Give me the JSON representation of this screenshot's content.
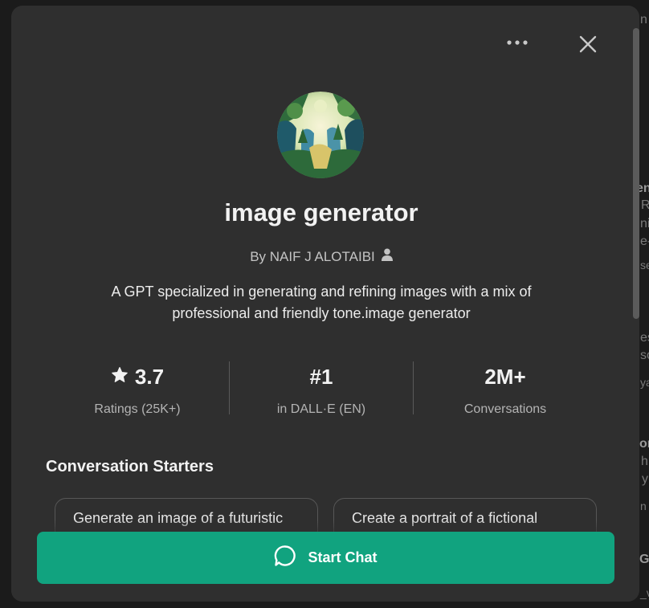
{
  "gpt": {
    "name": "image generator",
    "author": "By NAIF J ALOTAIBI",
    "description": "A GPT specialized in generating and refining images with a mix of professional and friendly tone.image generator"
  },
  "stats": [
    {
      "value": "3.7",
      "label": "Ratings (25K+)",
      "icon": "star-icon"
    },
    {
      "value": "#1",
      "label": "in DALL·E (EN)"
    },
    {
      "value": "2M+",
      "label": "Conversations"
    }
  ],
  "starters": {
    "title": "Conversation Starters",
    "items": [
      "Generate an image of a futuristic",
      "Create a portrait of a fictional"
    ]
  },
  "actions": {
    "start_chat": "Start Chat"
  },
  "icons": {
    "more": "more-horizontal-icon",
    "close": "close-icon",
    "author": "user-icon",
    "chat": "chat-bubble-icon"
  },
  "background": {
    "fragments": [
      "n",
      "en",
      "R",
      "ni",
      "e-",
      "se",
      "es",
      "so",
      "ya",
      "or",
      "h",
      "y",
      "n",
      "G",
      "_v"
    ]
  },
  "colors": {
    "accent": "#11a37f",
    "modal": "#2f2f2f",
    "backdrop": "#1b1b1b"
  }
}
